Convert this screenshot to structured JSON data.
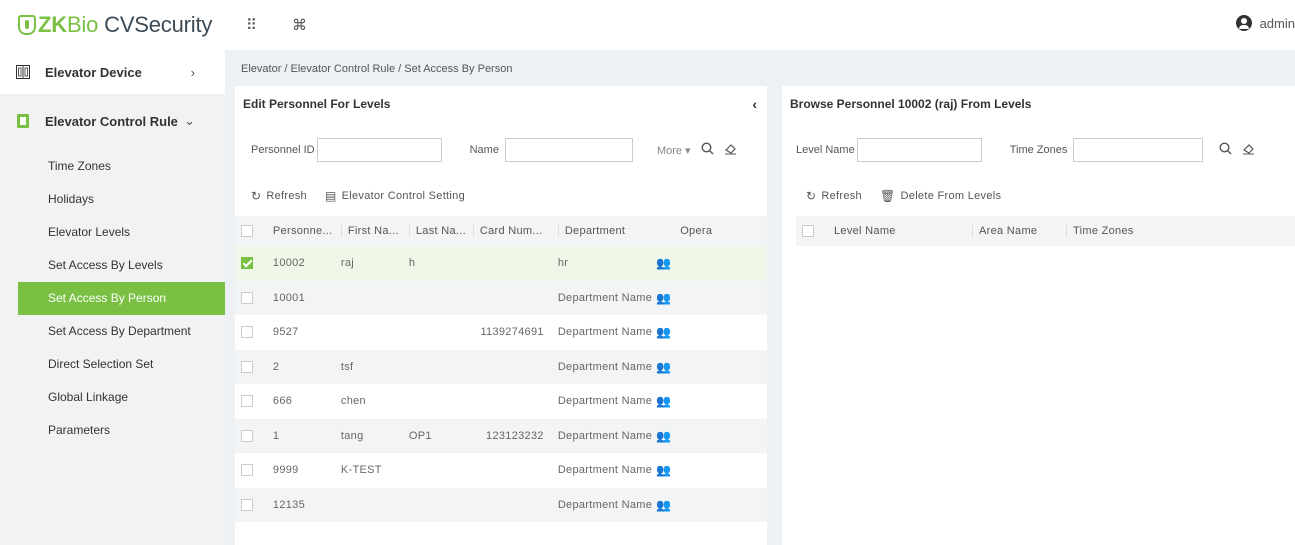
{
  "app": {
    "logo_zk": "ZK",
    "logo_bio": "Bio",
    "logo_product": "CVSecurity",
    "apps_icon": "grid-icon",
    "cmd_icon": "command-icon",
    "user": "admin"
  },
  "sidebar": {
    "menus": [
      {
        "label": "Elevator Device",
        "icon": "elevator-device-icon",
        "arrow": "›"
      },
      {
        "label": "Elevator Control Rule",
        "icon": "elevator-rule-icon",
        "arrow": "⌄"
      }
    ],
    "sub_items": [
      {
        "label": "Time Zones"
      },
      {
        "label": "Holidays"
      },
      {
        "label": "Elevator Levels"
      },
      {
        "label": "Set Access By Levels"
      },
      {
        "label": "Set Access By Person"
      },
      {
        "label": "Set Access By Department"
      },
      {
        "label": "Direct Selection Set"
      },
      {
        "label": "Global Linkage"
      },
      {
        "label": "Parameters"
      }
    ],
    "active_index": 4
  },
  "breadcrumb": "Elevator / Elevator Control Rule / Set Access By Person",
  "left_panel": {
    "title": "Edit Personnel For Levels",
    "collapse_label": "‹",
    "filter": {
      "personnel_id_label": "Personnel ID",
      "personnel_id_value": "",
      "name_label": "Name",
      "name_value": "",
      "more_label": "More ▾"
    },
    "toolbar": {
      "refresh": "Refresh",
      "setting": "Elevator Control Setting"
    },
    "columns": [
      "Personne...",
      "First Na...",
      "Last Na...",
      "Card Num...",
      "Department",
      "Opera"
    ],
    "rows": [
      {
        "id": "10002",
        "first": "raj",
        "last": "h",
        "card": "",
        "dept": "hr",
        "checked": true
      },
      {
        "id": "10001",
        "first": "",
        "last": "",
        "card": "",
        "dept": "Department Name",
        "checked": false
      },
      {
        "id": "9527",
        "first": "",
        "last": "",
        "card": "1139274691",
        "dept": "Department Name",
        "checked": false
      },
      {
        "id": "2",
        "first": "tsf",
        "last": "",
        "card": "",
        "dept": "Department Name",
        "checked": false
      },
      {
        "id": "666",
        "first": "chen",
        "last": "",
        "card": "",
        "dept": "Department Name",
        "checked": false
      },
      {
        "id": "1",
        "first": "tang",
        "last": "OP1",
        "card": "123123232",
        "dept": "Department Name",
        "checked": false
      },
      {
        "id": "9999",
        "first": "K-TEST",
        "last": "",
        "card": "",
        "dept": "Department Name",
        "checked": false
      },
      {
        "id": "12135",
        "first": "",
        "last": "",
        "card": "",
        "dept": "Department Name",
        "checked": false
      }
    ]
  },
  "right_panel": {
    "title": "Browse Personnel 10002  (raj)  From Levels",
    "filter": {
      "level_name_label": "Level Name",
      "level_name_value": "",
      "time_zones_label": "Time Zones",
      "time_zones_value": ""
    },
    "toolbar": {
      "refresh": "Refresh",
      "delete": "Delete From Levels"
    },
    "columns": [
      "Level Name",
      "Area Name",
      "Time Zones"
    ]
  },
  "colors": {
    "brand_green": "#7ac143",
    "content_bg": "#eef1f4"
  }
}
